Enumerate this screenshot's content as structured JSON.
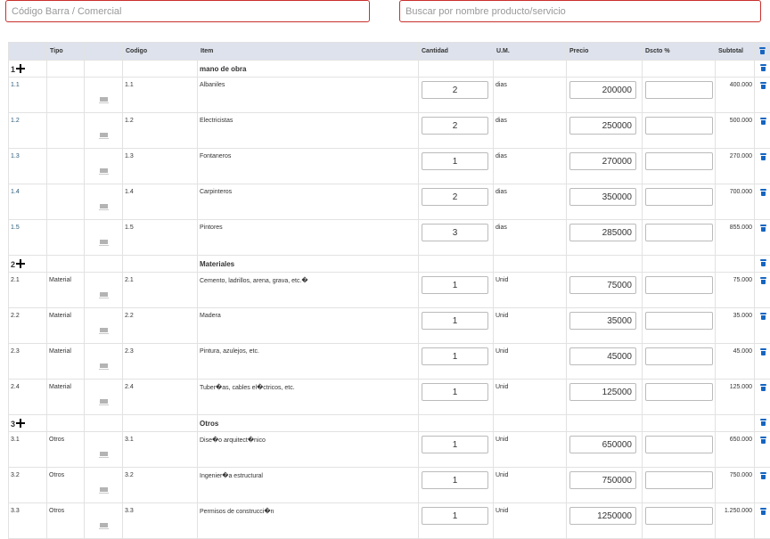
{
  "search": {
    "code_placeholder": "Código Barra / Comercial",
    "name_placeholder": "Buscar por nombre producto/servicio"
  },
  "table": {
    "headers": {
      "num": "",
      "tipo": "Tipo",
      "img": "",
      "codigo": "Codigo",
      "item": "Item",
      "cantidad": "Cantidad",
      "um": "U.M.",
      "precio": "Precio",
      "dscto": "Dscto %",
      "subtotal": "Subtotal"
    },
    "groups": [
      {
        "number": "1",
        "title": "mano de obra",
        "rows": [
          {
            "num": "1.1",
            "tipo": "",
            "codigo": "1.1",
            "item": "Albaniles",
            "cantidad": "2",
            "um": "dias",
            "precio": "200000",
            "dscto": "",
            "subtotal": "400.000"
          },
          {
            "num": "1.2",
            "tipo": "",
            "codigo": "1.2",
            "item": "Electricistas",
            "cantidad": "2",
            "um": "dias",
            "precio": "250000",
            "dscto": "",
            "subtotal": "500.000"
          },
          {
            "num": "1.3",
            "tipo": "",
            "codigo": "1.3",
            "item": "Fontaneros",
            "cantidad": "1",
            "um": "dias",
            "precio": "270000",
            "dscto": "",
            "subtotal": "270.000"
          },
          {
            "num": "1.4",
            "tipo": "",
            "codigo": "1.4",
            "item": "Carpinteros",
            "cantidad": "2",
            "um": "dias",
            "precio": "350000",
            "dscto": "",
            "subtotal": "700.000"
          },
          {
            "num": "1.5",
            "tipo": "",
            "codigo": "1.5",
            "item": "Pintores",
            "cantidad": "3",
            "um": "dias",
            "precio": "285000",
            "dscto": "",
            "subtotal": "855.000"
          }
        ]
      },
      {
        "number": "2",
        "title": "Materiales",
        "rows": [
          {
            "num": "2.1",
            "tipo": "Material",
            "codigo": "2.1",
            "item": "Cemento, ladrillos, arena, grava, etc.�",
            "cantidad": "1",
            "um": "Unid",
            "precio": "75000",
            "dscto": "",
            "subtotal": "75.000"
          },
          {
            "num": "2.2",
            "tipo": "Material",
            "codigo": "2.2",
            "item": "Madera",
            "cantidad": "1",
            "um": "Unid",
            "precio": "35000",
            "dscto": "",
            "subtotal": "35.000"
          },
          {
            "num": "2.3",
            "tipo": "Material",
            "codigo": "2.3",
            "item": "Pintura, azulejos, etc.",
            "cantidad": "1",
            "um": "Unid",
            "precio": "45000",
            "dscto": "",
            "subtotal": "45.000"
          },
          {
            "num": "2.4",
            "tipo": "Material",
            "codigo": "2.4",
            "item": "Tuber�as, cables el�ctricos, etc.",
            "cantidad": "1",
            "um": "Unid",
            "precio": "125000",
            "dscto": "",
            "subtotal": "125.000"
          }
        ]
      },
      {
        "number": "3",
        "title": "Otros",
        "rows": [
          {
            "num": "3.1",
            "tipo": "Otros",
            "codigo": "3.1",
            "item": "Dise�o arquitect�nico",
            "cantidad": "1",
            "um": "Unid",
            "precio": "650000",
            "dscto": "",
            "subtotal": "650.000"
          },
          {
            "num": "3.2",
            "tipo": "Otros",
            "codigo": "3.2",
            "item": "Ingenier�a estructural",
            "cantidad": "1",
            "um": "Unid",
            "precio": "750000",
            "dscto": "",
            "subtotal": "750.000"
          },
          {
            "num": "3.3",
            "tipo": "Otros",
            "codigo": "3.3",
            "item": "Permisos de construcci�n",
            "cantidad": "1",
            "um": "Unid",
            "precio": "1250000",
            "dscto": "",
            "subtotal": "1.250.000"
          }
        ]
      }
    ]
  },
  "icons": {
    "add": "plus-icon",
    "delete": "trash-icon",
    "thumbnail": "image-placeholder-icon"
  },
  "colors": {
    "search_border": "#c9302c",
    "header_bg": "#dde2ec",
    "trash": "#1565c0"
  }
}
